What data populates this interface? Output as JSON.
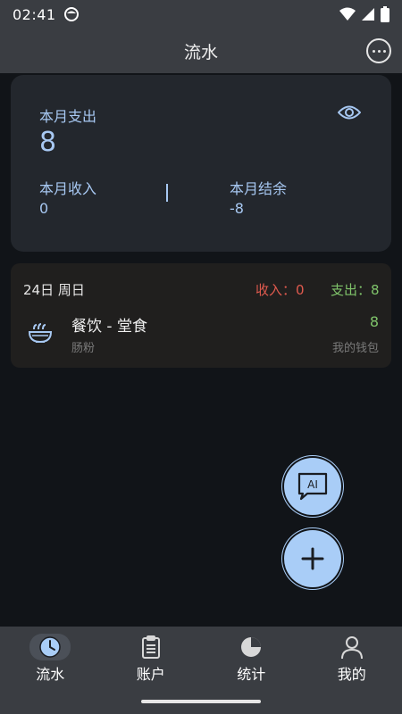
{
  "status_bar": {
    "time": "02:41"
  },
  "app_bar": {
    "title": "流水"
  },
  "summary": {
    "expense_label": "本月支出",
    "expense_value": "8",
    "income_label": "本月收入",
    "income_value": "0",
    "balance_label": "本月结余",
    "balance_value": "-8"
  },
  "day_group": {
    "date": "24日 周日",
    "income": "收入：0",
    "expense": "支出：8",
    "transactions": [
      {
        "category": "餐饮 - 堂食",
        "note": "肠粉",
        "amount": "8",
        "account": "我的钱包",
        "icon": "noodle-bowl-icon"
      }
    ]
  },
  "fab": {
    "ai_label": "AI"
  },
  "bottom_nav": [
    {
      "label": "流水",
      "icon": "clock-icon",
      "active": true
    },
    {
      "label": "账户",
      "icon": "clipboard-icon",
      "active": false
    },
    {
      "label": "统计",
      "icon": "pie-chart-icon",
      "active": false
    },
    {
      "label": "我的",
      "icon": "person-icon",
      "active": false
    }
  ],
  "colors": {
    "accent": "#a7c8f2",
    "income": "#e05a4e",
    "expense": "#7fc36a",
    "card": "#23272d",
    "bar": "#3a3d42"
  }
}
